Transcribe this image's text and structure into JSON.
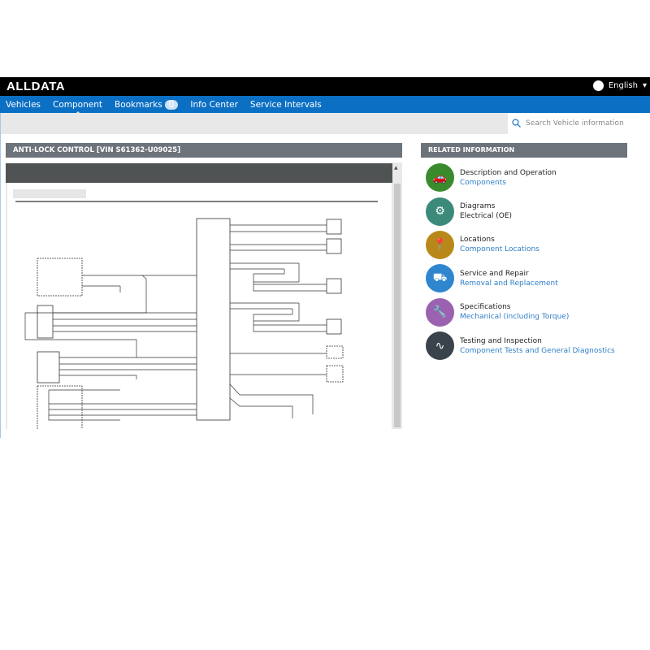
{
  "header": {
    "logo": "ALLDATA",
    "language": "English"
  },
  "nav": {
    "vehicles": "Vehicles",
    "component": "Component",
    "bookmarks": "Bookmarks",
    "bookmarks_count": "0",
    "info_center": "Info Center",
    "service_intervals": "Service Intervals"
  },
  "search": {
    "placeholder": "Search Vehicle information"
  },
  "main": {
    "title": "ANTI-LOCK CONTROL [VIN S61362-U09025]"
  },
  "related": {
    "title": "RELATED INFORMATION",
    "items": [
      {
        "title": "Description and Operation",
        "link": "Components",
        "color": "#3a8a2e",
        "icon": "car-description-icon"
      },
      {
        "title": "Diagrams",
        "link": "Electrical (OE)",
        "color": "#3b8a7a",
        "icon": "diagram-icon"
      },
      {
        "title": "Locations",
        "link": "Component Locations",
        "color": "#b8891a",
        "icon": "location-pin-icon"
      },
      {
        "title": "Service and Repair",
        "link": "Removal and Replacement",
        "color": "#2f86cf",
        "icon": "vehicle-lift-icon"
      },
      {
        "title": "Specifications",
        "link": "Mechanical (including Torque)",
        "color": "#9a62b0",
        "icon": "wrench-icon"
      },
      {
        "title": "Testing and Inspection",
        "link": "Component Tests and General Diagnostics",
        "color": "#3a424b",
        "icon": "oscilloscope-icon"
      }
    ]
  }
}
